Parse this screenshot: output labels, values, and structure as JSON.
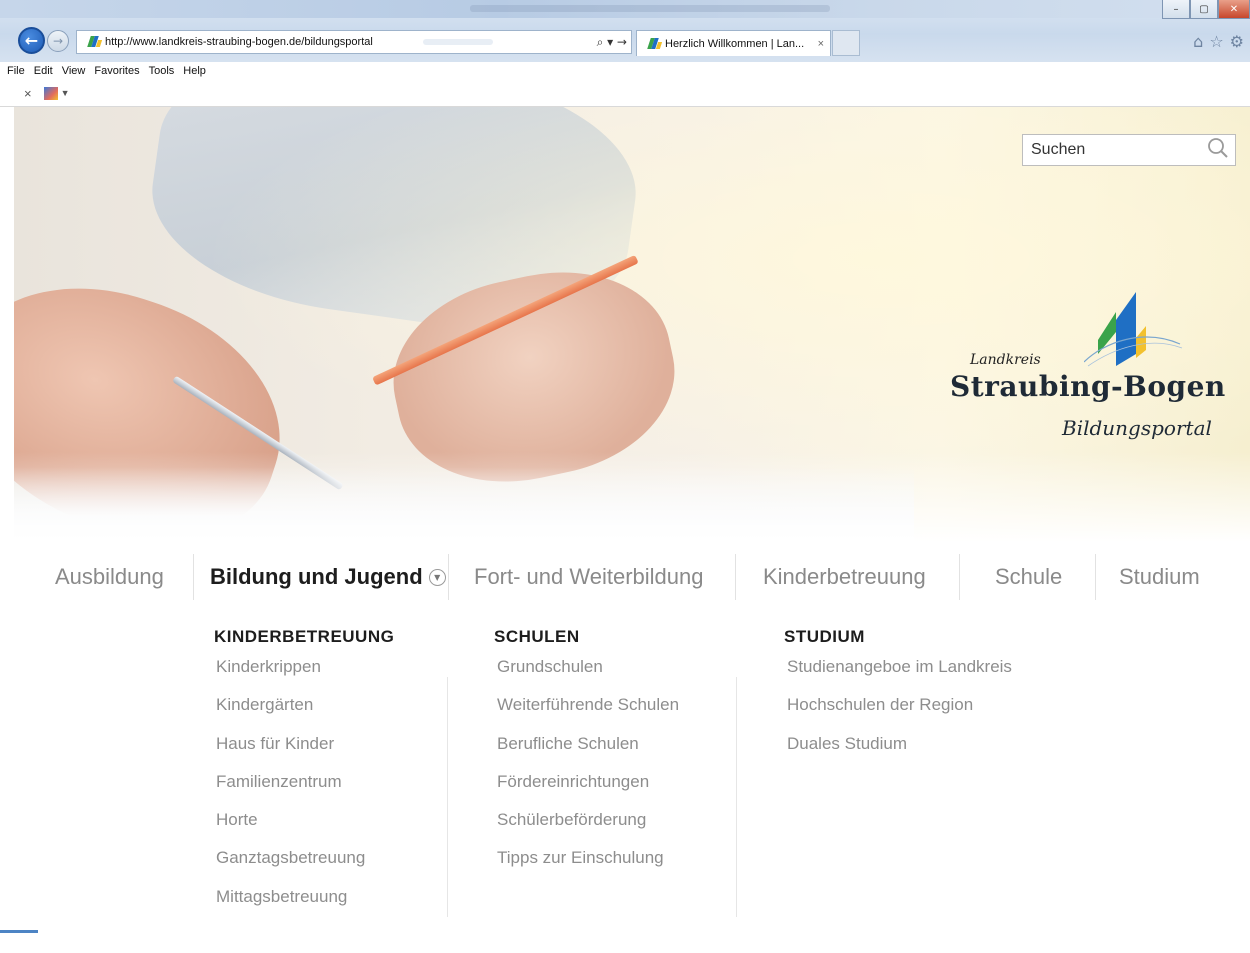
{
  "browser": {
    "url": "http://www.landkreis-straubing-bogen.de/bildungsportal",
    "tab_title": "Herzlich Willkommen | Lan...",
    "tab_close": "×",
    "menu": [
      "File",
      "Edit",
      "View",
      "Favorites",
      "Tools",
      "Help"
    ],
    "addr_tools": "⌕ ▾ →",
    "cmd_close": "×",
    "window_buttons": [
      "–",
      "▢",
      "✕"
    ],
    "right_icons": [
      "⌂",
      "☆",
      "⚙"
    ]
  },
  "search": {
    "placeholder": "Suchen"
  },
  "logo": {
    "landkreis": "Landkreis",
    "name": "Straubing-Bogen",
    "subtitle": "Bildungsportal"
  },
  "nav": {
    "items": [
      {
        "label": "Ausbildung"
      },
      {
        "label": "Bildung und Jugend"
      },
      {
        "label": "Fort- und Weiterbildung"
      },
      {
        "label": "Kinderbetreuung"
      },
      {
        "label": "Schule"
      },
      {
        "label": "Studium"
      }
    ],
    "active_index": 1
  },
  "megamenu": {
    "columns": [
      {
        "heading": "KINDERBETREUUNG",
        "links": [
          "Kinderkrippen",
          "Kindergärten",
          "Haus für Kinder",
          "Familienzentrum",
          "Horte",
          "Ganztagsbetreuung",
          "Mittagsbetreuung"
        ]
      },
      {
        "heading": "SCHULEN",
        "links": [
          "Grundschulen",
          "Weiterführende Schulen",
          "Berufliche Schulen",
          "Fördereinrichtungen",
          "Schülerbeförderung",
          "Tipps zur Einschulung"
        ]
      },
      {
        "heading": "STUDIUM",
        "links": [
          "Studienangeboe im Landkreis",
          "Hochschulen der Region",
          "Duales Studium"
        ]
      }
    ]
  },
  "colors": {
    "accent_blue": "#1d5bb5",
    "logo_blue": "#1f6fc4",
    "logo_green": "#3aa34a",
    "logo_yellow": "#f2c12e"
  }
}
